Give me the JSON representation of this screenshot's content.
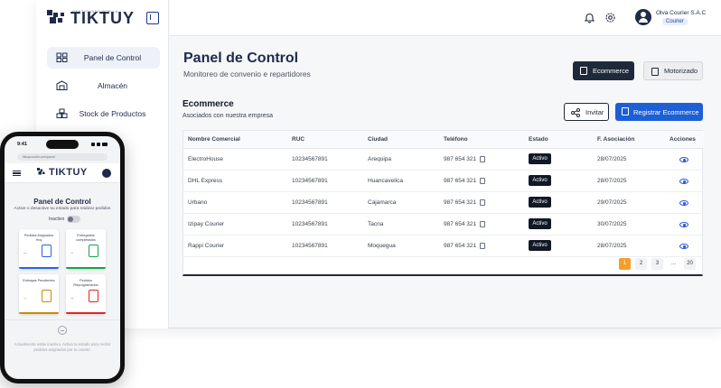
{
  "brand": {
    "name": "TIKTUY",
    "tagline": "GESTIONADO POR LA"
  },
  "sidebar": {
    "items": [
      {
        "label": "Panel de Control",
        "icon": "grid-icon",
        "active": true
      },
      {
        "label": "Almacén",
        "icon": "warehouse-icon",
        "active": false
      },
      {
        "label": "Stock de Productos",
        "icon": "boxes-icon",
        "active": false
      }
    ]
  },
  "topbar": {
    "user_name": "Olva Courier S.A.C",
    "user_role": "Courier"
  },
  "page": {
    "title": "Panel de Control",
    "subtitle": "Monitoreo de convenio e repartidores",
    "tabs": [
      {
        "label": "Ecommerce",
        "active": true
      },
      {
        "label": "Motorizado",
        "active": false
      }
    ]
  },
  "section": {
    "title": "Ecommerce",
    "subtitle": "Asociados con nuestra empresa",
    "invite_label": "Invitar",
    "register_label": "Registrar Ecommerce"
  },
  "table": {
    "headers": [
      "Nombre Comercial",
      "RUC",
      "Ciudad",
      "Teléfono",
      "Estado",
      "F. Asociación",
      "Acciones"
    ],
    "rows": [
      {
        "name": "ElectroHouse",
        "ruc": "10234567891",
        "city": "Arequipa",
        "phone": "987 654 321",
        "status": "Activo",
        "date": "28/07/2025"
      },
      {
        "name": "DHL Express",
        "ruc": "10234567891",
        "city": "Huancavelica",
        "phone": "987 654 321",
        "status": "Activo",
        "date": "28/07/2025"
      },
      {
        "name": "Urbano",
        "ruc": "10234567891",
        "city": "Cajamarca",
        "phone": "987 654 321",
        "status": "Activo",
        "date": "29/07/2025"
      },
      {
        "name": "Izipay Courier",
        "ruc": "10234567891",
        "city": "Tacna",
        "phone": "987 654 321",
        "status": "Activo",
        "date": "30/07/2025"
      },
      {
        "name": "Rappi Courier",
        "ruc": "10234567891",
        "city": "Moquegua",
        "phone": "987 654 321",
        "status": "Activo",
        "date": "28/07/2025"
      }
    ],
    "pagination": [
      "1",
      "2",
      "3",
      "...",
      "20"
    ]
  },
  "mobile": {
    "time": "9:41",
    "url": "tiktuycourier.com/panel",
    "title": "Panel de Control",
    "subtitle": "Active o desactive su estado para realizar pedidos",
    "toggle_label": "Inactivo",
    "cards": [
      {
        "label": "Pedidos Asignados Hoy",
        "value": "--",
        "color": "#2563eb"
      },
      {
        "label": "Entregados completados",
        "value": "--",
        "color": "#16a34a"
      },
      {
        "label": "Entregas Pendientes",
        "value": "--",
        "color": "#ca8a04"
      },
      {
        "label": "Pedidos Reprogramados",
        "value": "--",
        "color": "#dc2626"
      }
    ],
    "message": "Actualmente estás inactivo. Activa tu estado para recibir pedidos asignados por tu courier."
  },
  "colors": {
    "primary": "#1e2a4a",
    "accent": "#1d5fd6",
    "pager_active": "#f59e2a"
  }
}
